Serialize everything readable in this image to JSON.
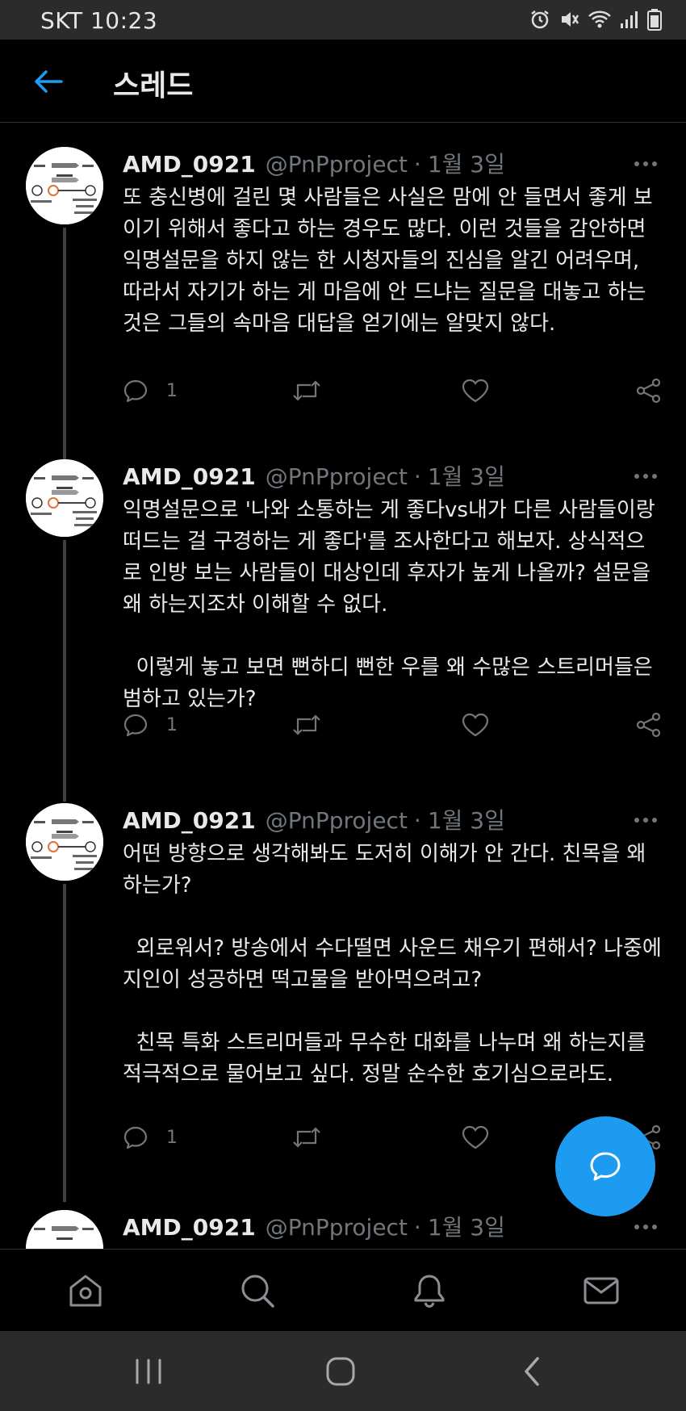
{
  "status_bar": {
    "carrier_time": "SKT 10:23",
    "icons": [
      "alarm-icon",
      "vibrate-mute-icon",
      "wifi-icon",
      "signal-icon",
      "battery-icon"
    ]
  },
  "header": {
    "title": "스레드",
    "back_icon": "arrow-left-icon"
  },
  "tweets": [
    {
      "name": "AMD_0921",
      "handle": "@PnPproject",
      "dot": "·",
      "date": "1월 3일",
      "body": [
        "또 충신병에 걸린 몇 사람들은 사실은 맘에 안 들면서 좋게 보이기 위해서 좋다고 하는 경우도 많다. 이런 것들을 감안하면 익명설문을 하지 않는 한 시청자들의 진심을 알긴 어려우며, 따라서 자기가 하는 게 마음에 안 드냐는 질문을 대놓고 하는 것은 그들의 속마음 대답을 얻기에는 알맞지 않다."
      ],
      "reply_count": "1"
    },
    {
      "name": "AMD_0921",
      "handle": "@PnPproject",
      "dot": "·",
      "date": "1월 3일",
      "body": [
        "익명설문으로 '나와 소통하는 게 좋다vs내가 다른 사람들이랑 떠드는 걸 구경하는 게 좋다'를 조사한다고 해보자. 상식적으로 인방 보는 사람들이 대상인데 후자가 높게 나올까? 설문을 왜 하는지조차 이해할 수 없다.",
        "  이렇게 놓고 보면 뻔하디 뻔한 우를 왜 수많은 스트리머들은 범하고 있는가?"
      ],
      "reply_count": "1"
    },
    {
      "name": "AMD_0921",
      "handle": "@PnPproject",
      "dot": "·",
      "date": "1월 3일",
      "body": [
        "어떤 방향으로 생각해봐도 도저히 이해가 안 간다. 친목을 왜 하는가?",
        "  외로워서? 방송에서 수다떨면 사운드 채우기 편해서? 나중에 지인이 성공하면 떡고물을 받아먹으려고?",
        "  친목 특화 스트리머들과 무수한 대화를 나누며 왜 하는지를 적극적으로 물어보고 싶다. 정말 순수한 호기심으로라도."
      ],
      "reply_count": "1"
    },
    {
      "name": "AMD_0921",
      "handle": "@PnPproject",
      "dot": "·",
      "date": "1월 3일",
      "body": [],
      "reply_count": ""
    }
  ],
  "bottom_tabs": [
    "home-icon",
    "search-icon",
    "notifications-icon",
    "messages-icon"
  ],
  "colors": {
    "accent": "#1d9bf0",
    "background": "#000000",
    "secondary_text": "#71767b"
  }
}
